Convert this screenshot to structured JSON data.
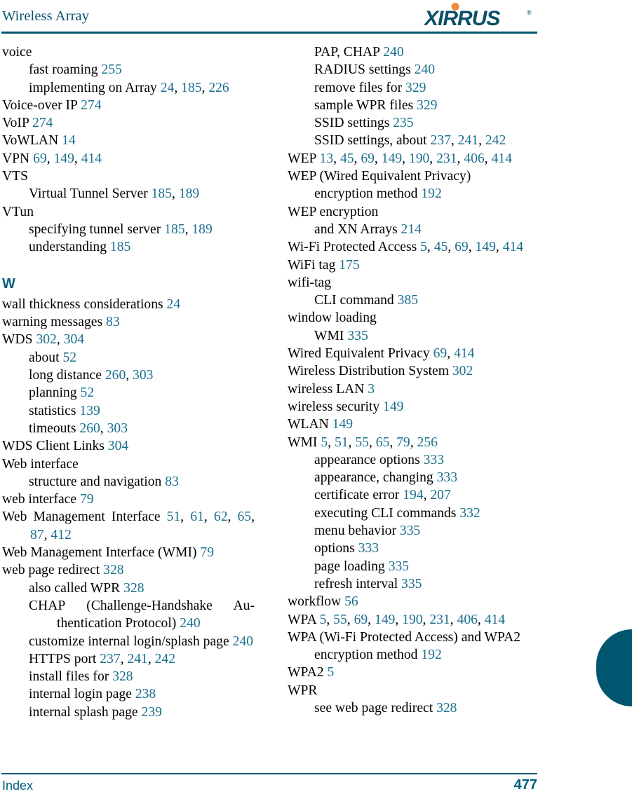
{
  "header": {
    "title": "Wireless Array",
    "logo_text": "XIRRUS",
    "logo_trademark": "®",
    "brand_color": "#00556f",
    "accent_color": "#f08a3c"
  },
  "footer": {
    "section_label": "Index",
    "page_number": "477"
  },
  "colors": {
    "page_number_link": "#1a6f8e",
    "heading_teal": "#00607e",
    "rule": "#00556f"
  },
  "left_column": [
    {
      "level": 0,
      "text": "voice",
      "pages": ""
    },
    {
      "level": 1,
      "text": "fast roaming",
      "pages": "255"
    },
    {
      "level": 1,
      "text": "implementing on Array",
      "pages": "24, 185, 226",
      "justify": true
    },
    {
      "level": 0,
      "text": "Voice-over IP",
      "pages": "274"
    },
    {
      "level": 0,
      "text": "VoIP",
      "pages": "274"
    },
    {
      "level": 0,
      "text": "VoWLAN",
      "pages": "14"
    },
    {
      "level": 0,
      "text": "VPN",
      "pages": "69, 149, 414"
    },
    {
      "level": 0,
      "text": "VTS",
      "pages": ""
    },
    {
      "level": 1,
      "text": "Virtual Tunnel Server",
      "pages": "185, 189"
    },
    {
      "level": 0,
      "text": "VTun",
      "pages": ""
    },
    {
      "level": 1,
      "text": "specifying tunnel server",
      "pages": "185, 189"
    },
    {
      "level": 1,
      "text": "understanding",
      "pages": "185"
    },
    {
      "level": -1,
      "section_letter": "W"
    },
    {
      "level": 0,
      "text": "wall thickness considerations",
      "pages": "24"
    },
    {
      "level": 0,
      "text": "warning messages",
      "pages": "83"
    },
    {
      "level": 0,
      "text": "WDS",
      "pages": "302, 304"
    },
    {
      "level": 1,
      "text": "about",
      "pages": "52"
    },
    {
      "level": 1,
      "text": "long distance",
      "pages": "260, 303"
    },
    {
      "level": 1,
      "text": "planning",
      "pages": "52"
    },
    {
      "level": 1,
      "text": "statistics",
      "pages": "139"
    },
    {
      "level": 1,
      "text": "timeouts",
      "pages": "260, 303"
    },
    {
      "level": 0,
      "text": "WDS Client Links",
      "pages": "304"
    },
    {
      "level": 0,
      "text": "Web interface",
      "pages": ""
    },
    {
      "level": 1,
      "text": "structure and navigation",
      "pages": "83"
    },
    {
      "level": 0,
      "text": "web interface",
      "pages": "79"
    },
    {
      "level": 0,
      "text": "Web Management Interface",
      "pages": "51, 61, 62, 65, 87, 412",
      "justify": true
    },
    {
      "level": 0,
      "text": "Web Management Interface (WMI)",
      "pages": "79"
    },
    {
      "level": 0,
      "text": "web page redirect",
      "pages": "328"
    },
    {
      "level": 1,
      "text": "also called WPR",
      "pages": "328"
    },
    {
      "level": 1,
      "text": "CHAP (Challenge-Handshake Au-thentication Protocol)",
      "pages": "240",
      "justify": true
    },
    {
      "level": 1,
      "text": "customize internal login/splash page",
      "pages": "240",
      "justify": true
    },
    {
      "level": 1,
      "text": "HTTPS port",
      "pages": "237, 241, 242"
    },
    {
      "level": 1,
      "text": "install files for",
      "pages": "328"
    },
    {
      "level": 1,
      "text": "internal login page",
      "pages": "238"
    },
    {
      "level": 1,
      "text": "internal splash page",
      "pages": "239"
    }
  ],
  "right_column": [
    {
      "level": 1,
      "text": "PAP, CHAP",
      "pages": "240"
    },
    {
      "level": 1,
      "text": "RADIUS settings",
      "pages": "240"
    },
    {
      "level": 1,
      "text": "remove files for",
      "pages": "329"
    },
    {
      "level": 1,
      "text": "sample WPR files",
      "pages": "329"
    },
    {
      "level": 1,
      "text": "SSID settings",
      "pages": "235"
    },
    {
      "level": 1,
      "text": "SSID settings, about",
      "pages": "237, 241, 242"
    },
    {
      "level": 0,
      "text": "WEP",
      "pages": "13, 45, 69, 149, 190, 231, 406, 414"
    },
    {
      "level": 0,
      "text": "WEP (Wired Equivalent Privacy)",
      "pages": ""
    },
    {
      "level": 1,
      "text": "encryption method",
      "pages": "192"
    },
    {
      "level": 0,
      "text": "WEP encryption",
      "pages": ""
    },
    {
      "level": 1,
      "text": "and XN Arrays",
      "pages": "214"
    },
    {
      "level": 0,
      "text": "Wi-Fi Protected Access",
      "pages": "5, 45, 69, 149, 414",
      "justify": true
    },
    {
      "level": 0,
      "text": "WiFi tag",
      "pages": "175"
    },
    {
      "level": 0,
      "text": "wifi-tag",
      "pages": ""
    },
    {
      "level": 1,
      "text": "CLI command",
      "pages": "385"
    },
    {
      "level": 0,
      "text": "window loading",
      "pages": ""
    },
    {
      "level": 1,
      "text": "WMI",
      "pages": "335"
    },
    {
      "level": 0,
      "text": "Wired Equivalent Privacy",
      "pages": "69, 414"
    },
    {
      "level": 0,
      "text": "Wireless Distribution System",
      "pages": "302"
    },
    {
      "level": 0,
      "text": "wireless LAN",
      "pages": "3"
    },
    {
      "level": 0,
      "text": "wireless security",
      "pages": "149"
    },
    {
      "level": 0,
      "text": "WLAN",
      "pages": "149"
    },
    {
      "level": 0,
      "text": "WMI",
      "pages": "5, 51, 55, 65, 79, 256"
    },
    {
      "level": 1,
      "text": "appearance options",
      "pages": "333"
    },
    {
      "level": 1,
      "text": "appearance, changing",
      "pages": "333"
    },
    {
      "level": 1,
      "text": "certificate error",
      "pages": "194, 207"
    },
    {
      "level": 1,
      "text": "executing CLI commands",
      "pages": "332"
    },
    {
      "level": 1,
      "text": "menu behavior",
      "pages": "335"
    },
    {
      "level": 1,
      "text": "options",
      "pages": "333"
    },
    {
      "level": 1,
      "text": "page loading",
      "pages": "335"
    },
    {
      "level": 1,
      "text": "refresh interval",
      "pages": "335"
    },
    {
      "level": 0,
      "text": "workflow",
      "pages": "56"
    },
    {
      "level": 0,
      "text": "WPA",
      "pages": "5, 55, 69, 149, 190, 231, 406, 414"
    },
    {
      "level": 0,
      "text": "WPA (Wi-Fi Protected Access) and WPA2",
      "pages": "",
      "justify": true
    },
    {
      "level": 1,
      "text": "encryption method",
      "pages": "192"
    },
    {
      "level": 0,
      "text": "WPA2",
      "pages": "5"
    },
    {
      "level": 0,
      "text": "WPR",
      "pages": ""
    },
    {
      "level": 1,
      "text": "see web page redirect",
      "pages": "328"
    }
  ]
}
